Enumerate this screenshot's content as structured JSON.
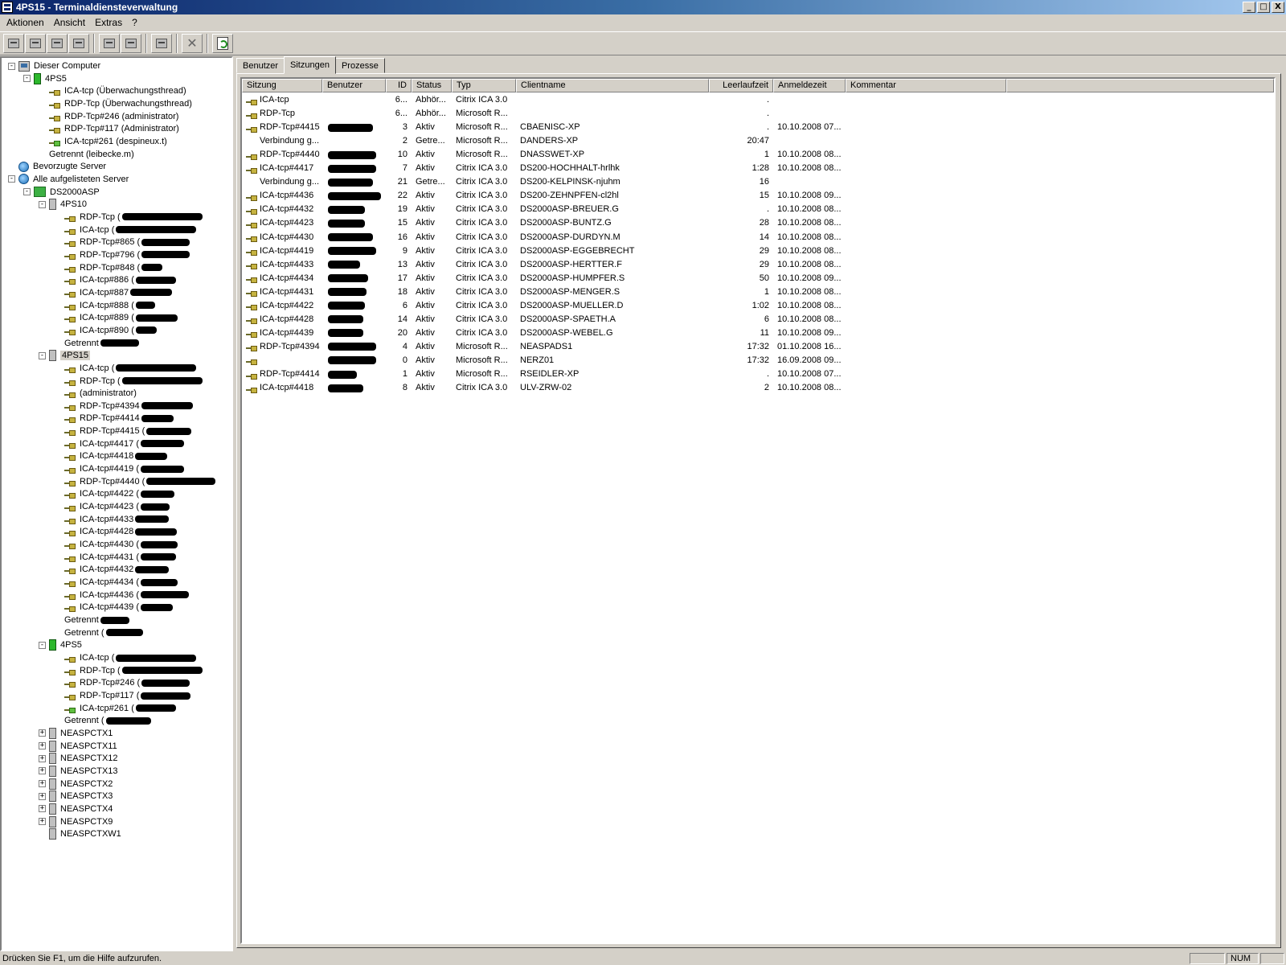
{
  "window": {
    "title": "4PS15 - Terminaldiensteverwaltung",
    "buttons": [
      "_",
      "□",
      "X"
    ]
  },
  "menu": {
    "items": [
      "Aktionen",
      "Ansicht",
      "Extras",
      "?"
    ]
  },
  "toolbar": {
    "icons": [
      "connect-icon",
      "disconnect-icon",
      "send-message-icon",
      "remote-control-icon",
      "reset-icon",
      "status-icon",
      "logoff-icon",
      "end-process-icon",
      "refresh-icon"
    ],
    "delete_glyph": "✕"
  },
  "tree": {
    "nodes": [
      {
        "label": "Dieser Computer",
        "level": 0,
        "exp": "-",
        "icon": "computer"
      },
      {
        "label": "4PS5",
        "level": 1,
        "exp": "-",
        "icon": "server-green"
      },
      {
        "label": "ICA-tcp (Überwachungsthread)",
        "level": 2,
        "exp": "",
        "icon": "session"
      },
      {
        "label": "RDP-Tcp (Überwachungsthread)",
        "level": 2,
        "exp": "",
        "icon": "session"
      },
      {
        "label": "RDP-Tcp#246 (administrator)",
        "level": 2,
        "exp": "",
        "icon": "session"
      },
      {
        "label": "RDP-Tcp#117 (Administrator)",
        "level": 2,
        "exp": "",
        "icon": "session"
      },
      {
        "label": "ICA-tcp#261 (despineux.t)",
        "level": 2,
        "exp": "",
        "icon": "session-green"
      },
      {
        "label": "Getrennt (leibecke.m)",
        "level": 2,
        "exp": "",
        "icon": "none"
      },
      {
        "label": "Bevorzugte Server",
        "level": 0,
        "exp": "",
        "icon": "globe"
      },
      {
        "label": "Alle aufgelisteten Server",
        "level": 0,
        "exp": "-",
        "icon": "globe"
      },
      {
        "label": "DS2000ASP",
        "level": 1,
        "exp": "-",
        "icon": "domain"
      },
      {
        "label": "4PS10",
        "level": 2,
        "exp": "-",
        "icon": "server-gray"
      },
      {
        "label": "RDP-Tcp (",
        "level": 3,
        "exp": "",
        "icon": "session",
        "redact": 100
      },
      {
        "label": "ICA-tcp (",
        "level": 3,
        "exp": "",
        "icon": "session",
        "redact": 100
      },
      {
        "label": "RDP-Tcp#865 (",
        "level": 3,
        "exp": "",
        "icon": "session",
        "redact": 60
      },
      {
        "label": "RDP-Tcp#796 (",
        "level": 3,
        "exp": "",
        "icon": "session",
        "redact": 60
      },
      {
        "label": "RDP-Tcp#848 (",
        "level": 3,
        "exp": "",
        "icon": "session",
        "redact": 26
      },
      {
        "label": "ICA-tcp#886 (",
        "level": 3,
        "exp": "",
        "icon": "session",
        "redact": 50
      },
      {
        "label": "ICA-tcp#887",
        "level": 3,
        "exp": "",
        "icon": "session",
        "redact": 52
      },
      {
        "label": "ICA-tcp#888 (",
        "level": 3,
        "exp": "",
        "icon": "session",
        "redact": 24
      },
      {
        "label": "ICA-tcp#889 (",
        "level": 3,
        "exp": "",
        "icon": "session",
        "redact": 52
      },
      {
        "label": "ICA-tcp#890 (",
        "level": 3,
        "exp": "",
        "icon": "session",
        "redact": 26
      },
      {
        "label": "Getrennt",
        "level": 3,
        "exp": "",
        "icon": "none",
        "redact": 48
      },
      {
        "label": "4PS15",
        "level": 2,
        "exp": "-",
        "icon": "server-gray",
        "selected": true
      },
      {
        "label": "ICA-tcp (",
        "level": 3,
        "exp": "",
        "icon": "session",
        "redact": 100
      },
      {
        "label": "RDP-Tcp (",
        "level": 3,
        "exp": "",
        "icon": "session",
        "redact": 100
      },
      {
        "label": "(administrator)",
        "level": 3,
        "exp": "",
        "icon": "session"
      },
      {
        "label": "RDP-Tcp#4394",
        "level": 3,
        "exp": "",
        "icon": "session",
        "redact": 64
      },
      {
        "label": "RDP-Tcp#4414",
        "level": 3,
        "exp": "",
        "icon": "session",
        "redact": 40
      },
      {
        "label": "RDP-Tcp#4415 (",
        "level": 3,
        "exp": "",
        "icon": "session",
        "redact": 56
      },
      {
        "label": "ICA-tcp#4417 (",
        "level": 3,
        "exp": "",
        "icon": "session",
        "redact": 54
      },
      {
        "label": "ICA-tcp#4418",
        "level": 3,
        "exp": "",
        "icon": "session",
        "redact": 40
      },
      {
        "label": "ICA-tcp#4419 (",
        "level": 3,
        "exp": "",
        "icon": "session",
        "redact": 54
      },
      {
        "label": "RDP-Tcp#4440 (",
        "level": 3,
        "exp": "",
        "icon": "session",
        "redact": 86
      },
      {
        "label": "ICA-tcp#4422 (",
        "level": 3,
        "exp": "",
        "icon": "session",
        "redact": 42
      },
      {
        "label": "ICA-tcp#4423 (",
        "level": 3,
        "exp": "",
        "icon": "session",
        "redact": 36
      },
      {
        "label": "ICA-tcp#4433",
        "level": 3,
        "exp": "",
        "icon": "session",
        "redact": 42
      },
      {
        "label": "ICA-tcp#4428",
        "level": 3,
        "exp": "",
        "icon": "session",
        "redact": 52
      },
      {
        "label": "ICA-tcp#4430 (",
        "level": 3,
        "exp": "",
        "icon": "session",
        "redact": 46
      },
      {
        "label": "ICA-tcp#4431 (",
        "level": 3,
        "exp": "",
        "icon": "session",
        "redact": 44
      },
      {
        "label": "ICA-tcp#4432",
        "level": 3,
        "exp": "",
        "icon": "session",
        "redact": 42
      },
      {
        "label": "ICA-tcp#4434 (",
        "level": 3,
        "exp": "",
        "icon": "session",
        "redact": 46
      },
      {
        "label": "ICA-tcp#4436 (",
        "level": 3,
        "exp": "",
        "icon": "session",
        "redact": 60
      },
      {
        "label": "ICA-tcp#4439 (",
        "level": 3,
        "exp": "",
        "icon": "session",
        "redact": 40
      },
      {
        "label": "Getrennt",
        "level": 3,
        "exp": "",
        "icon": "none",
        "redact": 36
      },
      {
        "label": "Getrennt (",
        "level": 3,
        "exp": "",
        "icon": "none",
        "redact": 46
      },
      {
        "label": "4PS5",
        "level": 2,
        "exp": "-",
        "icon": "server-green"
      },
      {
        "label": "ICA-tcp (",
        "level": 3,
        "exp": "",
        "icon": "session",
        "redact": 100
      },
      {
        "label": "RDP-Tcp (",
        "level": 3,
        "exp": "",
        "icon": "session",
        "redact": 100
      },
      {
        "label": "RDP-Tcp#246 (",
        "level": 3,
        "exp": "",
        "icon": "session",
        "redact": 60
      },
      {
        "label": "RDP-Tcp#117 (",
        "level": 3,
        "exp": "",
        "icon": "session",
        "redact": 62
      },
      {
        "label": "ICA-tcp#261 (",
        "level": 3,
        "exp": "",
        "icon": "session-green",
        "redact": 50
      },
      {
        "label": "Getrennt (",
        "level": 3,
        "exp": "",
        "icon": "none",
        "redact": 56
      },
      {
        "label": "NEASPCTX1",
        "level": 2,
        "exp": "+",
        "icon": "server-gray"
      },
      {
        "label": "NEASPCTX11",
        "level": 2,
        "exp": "+",
        "icon": "server-gray"
      },
      {
        "label": "NEASPCTX12",
        "level": 2,
        "exp": "+",
        "icon": "server-gray"
      },
      {
        "label": "NEASPCTX13",
        "level": 2,
        "exp": "+",
        "icon": "server-gray"
      },
      {
        "label": "NEASPCTX2",
        "level": 2,
        "exp": "+",
        "icon": "server-gray"
      },
      {
        "label": "NEASPCTX3",
        "level": 2,
        "exp": "+",
        "icon": "server-gray"
      },
      {
        "label": "NEASPCTX4",
        "level": 2,
        "exp": "+",
        "icon": "server-gray"
      },
      {
        "label": "NEASPCTX9",
        "level": 2,
        "exp": "+",
        "icon": "server-gray"
      },
      {
        "label": "NEASPCTXW1",
        "level": 2,
        "exp": "",
        "icon": "server-gray"
      }
    ]
  },
  "tabs": [
    {
      "label": "Benutzer",
      "active": false
    },
    {
      "label": "Sitzungen",
      "active": true
    },
    {
      "label": "Prozesse",
      "active": false
    }
  ],
  "table": {
    "columns": [
      {
        "label": "Sitzung",
        "cls": "w-sitzung"
      },
      {
        "label": "Benutzer",
        "cls": "w-benutzer"
      },
      {
        "label": "ID",
        "cls": "w-id",
        "right": true
      },
      {
        "label": "Status",
        "cls": "w-status"
      },
      {
        "label": "Typ",
        "cls": "w-typ"
      },
      {
        "label": "Clientname",
        "cls": "w-client"
      },
      {
        "label": "Leerlaufzeit",
        "cls": "w-leer",
        "right": true
      },
      {
        "label": "Anmeldezeit",
        "cls": "w-anmelde"
      },
      {
        "label": "Kommentar",
        "cls": "w-komm"
      },
      {
        "label": "",
        "cls": "w-rest"
      }
    ],
    "rows": [
      {
        "sitzung": "ICA-tcp",
        "icon": true,
        "redact": 0,
        "id": "6...",
        "status": "Abhör...",
        "typ": "Citrix ICA 3.0",
        "client": "",
        "leer": ".",
        "anmelde": ""
      },
      {
        "sitzung": "RDP-Tcp",
        "icon": true,
        "redact": 0,
        "id": "6...",
        "status": "Abhör...",
        "typ": "Microsoft R...",
        "client": "",
        "leer": ".",
        "anmelde": ""
      },
      {
        "sitzung": "RDP-Tcp#4415",
        "icon": true,
        "redact": 56,
        "id": "3",
        "status": "Aktiv",
        "typ": "Microsoft R...",
        "client": "CBAENISC-XP",
        "leer": ".",
        "anmelde": "10.10.2008 07..."
      },
      {
        "sitzung": "Verbindung g...",
        "icon": false,
        "redact": 0,
        "id": "2",
        "status": "Getre...",
        "typ": "Microsoft R...",
        "client": "DANDERS-XP",
        "leer": "20:47",
        "anmelde": ""
      },
      {
        "sitzung": "RDP-Tcp#4440",
        "icon": true,
        "redact": 60,
        "id": "10",
        "status": "Aktiv",
        "typ": "Microsoft R...",
        "client": "DNASSWET-XP",
        "leer": "1",
        "anmelde": "10.10.2008 08..."
      },
      {
        "sitzung": "ICA-tcp#4417",
        "icon": true,
        "redact": 60,
        "id": "7",
        "status": "Aktiv",
        "typ": "Citrix ICA 3.0",
        "client": "DS200-HOCHHALT-hrlhk",
        "leer": "1:28",
        "anmelde": "10.10.2008 08..."
      },
      {
        "sitzung": "Verbindung g...",
        "icon": false,
        "redact": 56,
        "id": "21",
        "status": "Getre...",
        "typ": "Citrix ICA 3.0",
        "client": "DS200-KELPINSK-njuhm",
        "leer": "16",
        "anmelde": ""
      },
      {
        "sitzung": "ICA-tcp#4436",
        "icon": true,
        "redact": 66,
        "id": "22",
        "status": "Aktiv",
        "typ": "Citrix ICA 3.0",
        "client": "DS200-ZEHNPFEN-cl2hl",
        "leer": "15",
        "anmelde": "10.10.2008 09..."
      },
      {
        "sitzung": "ICA-tcp#4432",
        "icon": true,
        "redact": 46,
        "id": "19",
        "status": "Aktiv",
        "typ": "Citrix ICA 3.0",
        "client": "DS2000ASP-BREUER.G",
        "leer": ".",
        "anmelde": "10.10.2008 08..."
      },
      {
        "sitzung": "ICA-tcp#4423",
        "icon": true,
        "redact": 46,
        "id": "15",
        "status": "Aktiv",
        "typ": "Citrix ICA 3.0",
        "client": "DS2000ASP-BUNTZ.G",
        "leer": "28",
        "anmelde": "10.10.2008 08..."
      },
      {
        "sitzung": "ICA-tcp#4430",
        "icon": true,
        "redact": 56,
        "id": "16",
        "status": "Aktiv",
        "typ": "Citrix ICA 3.0",
        "client": "DS2000ASP-DURDYN.M",
        "leer": "14",
        "anmelde": "10.10.2008 08..."
      },
      {
        "sitzung": "ICA-tcp#4419",
        "icon": true,
        "redact": 60,
        "id": "9",
        "status": "Aktiv",
        "typ": "Citrix ICA 3.0",
        "client": "DS2000ASP-EGGEBRECHT",
        "leer": "29",
        "anmelde": "10.10.2008 08..."
      },
      {
        "sitzung": "ICA-tcp#4433",
        "icon": true,
        "redact": 40,
        "id": "13",
        "status": "Aktiv",
        "typ": "Citrix ICA 3.0",
        "client": "DS2000ASP-HERTTER.F",
        "leer": "29",
        "anmelde": "10.10.2008 08..."
      },
      {
        "sitzung": "ICA-tcp#4434",
        "icon": true,
        "redact": 50,
        "id": "17",
        "status": "Aktiv",
        "typ": "Citrix ICA 3.0",
        "client": "DS2000ASP-HUMPFER.S",
        "leer": "50",
        "anmelde": "10.10.2008 09..."
      },
      {
        "sitzung": "ICA-tcp#4431",
        "icon": true,
        "redact": 48,
        "id": "18",
        "status": "Aktiv",
        "typ": "Citrix ICA 3.0",
        "client": "DS2000ASP-MENGER.S",
        "leer": "1",
        "anmelde": "10.10.2008 08..."
      },
      {
        "sitzung": "ICA-tcp#4422",
        "icon": true,
        "redact": 46,
        "id": "6",
        "status": "Aktiv",
        "typ": "Citrix ICA 3.0",
        "client": "DS2000ASP-MUELLER.D",
        "leer": "1:02",
        "anmelde": "10.10.2008 08..."
      },
      {
        "sitzung": "ICA-tcp#4428",
        "icon": true,
        "redact": 44,
        "id": "14",
        "status": "Aktiv",
        "typ": "Citrix ICA 3.0",
        "client": "DS2000ASP-SPAETH.A",
        "leer": "6",
        "anmelde": "10.10.2008 08..."
      },
      {
        "sitzung": "ICA-tcp#4439",
        "icon": true,
        "redact": 44,
        "id": "20",
        "status": "Aktiv",
        "typ": "Citrix ICA 3.0",
        "client": "DS2000ASP-WEBEL.G",
        "leer": "11",
        "anmelde": "10.10.2008 09..."
      },
      {
        "sitzung": "RDP-Tcp#4394",
        "icon": true,
        "redact": 60,
        "id": "4",
        "status": "Aktiv",
        "typ": "Microsoft R...",
        "client": "NEASPADS1",
        "leer": "17:32",
        "anmelde": "01.10.2008 16..."
      },
      {
        "sitzung": "",
        "icon": true,
        "redact": 60,
        "id": "0",
        "status": "Aktiv",
        "typ": "Microsoft R...",
        "client": "NERZ01",
        "leer": "17:32",
        "anmelde": "16.09.2008 09..."
      },
      {
        "sitzung": "RDP-Tcp#4414",
        "icon": true,
        "redact": 36,
        "id": "1",
        "status": "Aktiv",
        "typ": "Microsoft R...",
        "client": "RSEIDLER-XP",
        "leer": ".",
        "anmelde": "10.10.2008 07..."
      },
      {
        "sitzung": "ICA-tcp#4418",
        "icon": true,
        "redact": 44,
        "id": "8",
        "status": "Aktiv",
        "typ": "Citrix ICA 3.0",
        "client": "ULV-ZRW-02",
        "leer": "2",
        "anmelde": "10.10.2008 08..."
      }
    ]
  },
  "statusbar": {
    "text": "Drücken Sie F1, um die Hilfe aufzurufen.",
    "num": "NUM"
  }
}
